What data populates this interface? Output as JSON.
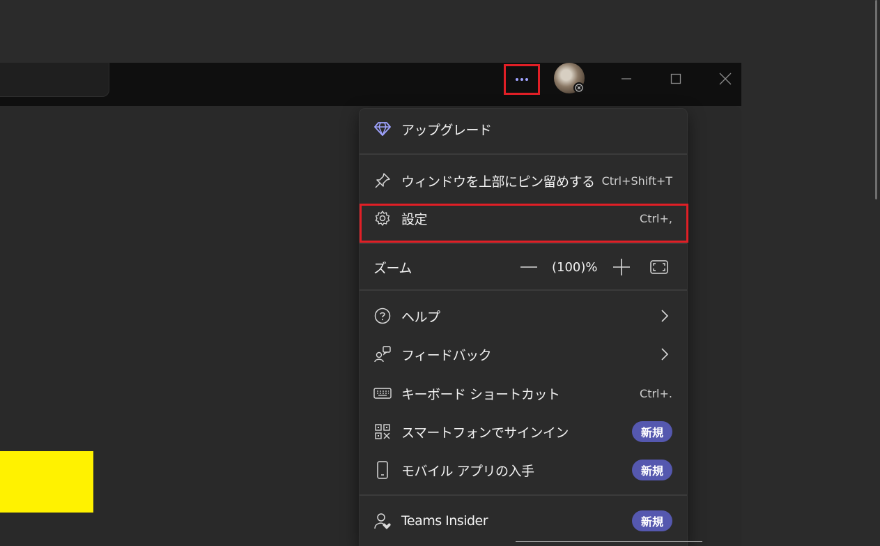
{
  "window": {
    "more_button_label": "•••",
    "controls": [
      "minimize",
      "maximize",
      "close"
    ]
  },
  "menu": {
    "upgrade": {
      "label": "アップグレード",
      "icon": "diamond-icon"
    },
    "pin": {
      "label": "ウィンドウを上部にピン留めする",
      "shortcut": "Ctrl+Shift+T",
      "icon": "pin-icon"
    },
    "settings": {
      "label": "設定",
      "shortcut": "Ctrl+,",
      "icon": "gear-icon"
    },
    "zoom": {
      "label": "ズーム",
      "value": "(100)%",
      "minus": "—",
      "plus": "+",
      "fit_icon": "fit-screen-icon"
    },
    "help": {
      "label": "ヘルプ",
      "icon": "help-icon"
    },
    "feedback": {
      "label": "フィードバック",
      "icon": "feedback-icon"
    },
    "keyboard": {
      "label": "キーボード ショートカット",
      "shortcut": "Ctrl+.",
      "icon": "keyboard-icon"
    },
    "smartphone": {
      "label": "スマートフォンでサインイン",
      "badge": "新規",
      "icon": "qr-code-icon"
    },
    "mobile": {
      "label": "モバイル アプリの入手",
      "badge": "新規",
      "icon": "phone-icon"
    },
    "insider": {
      "label": "Teams Insider",
      "badge": "新規",
      "icon": "person-heart-icon"
    }
  },
  "colors": {
    "accent": "#9fa3ff",
    "badge": "#5558af",
    "highlight": "#e01f26",
    "menu_bg": "#2b2b2b",
    "titlebar_bg": "#0f0f0f"
  }
}
